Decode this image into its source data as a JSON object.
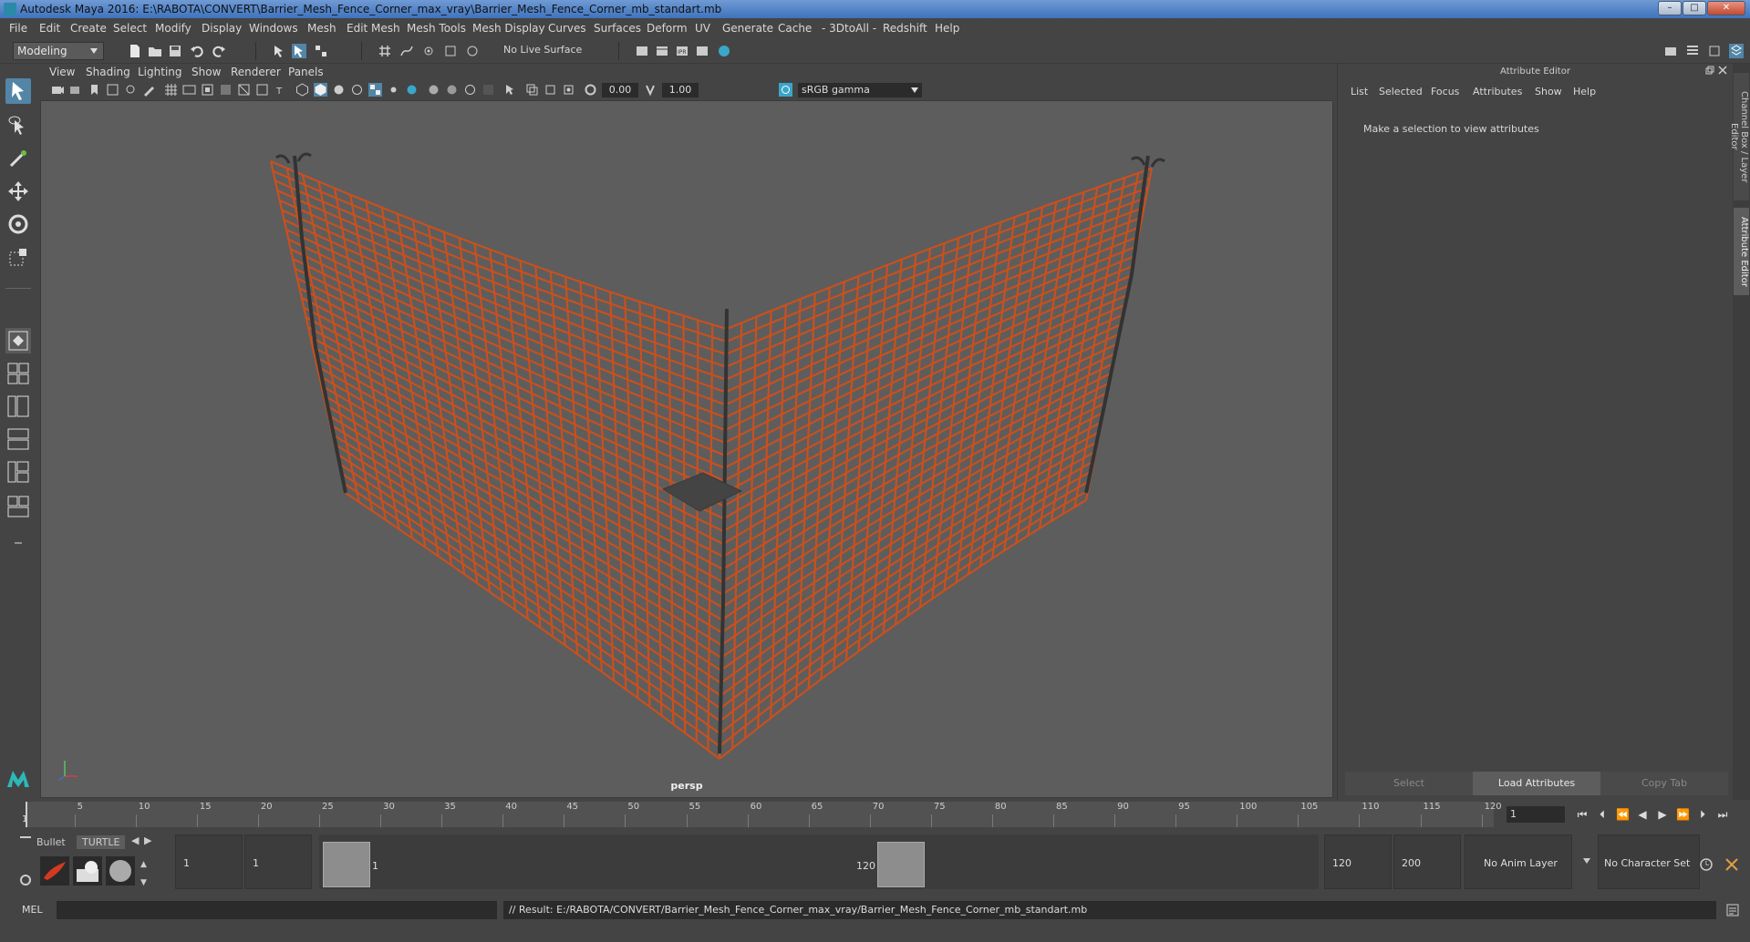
{
  "window": {
    "title": "Autodesk Maya 2016: E:\\RABOTA\\CONVERT\\Barrier_Mesh_Fence_Corner_max_vray\\Barrier_Mesh_Fence_Corner_mb_standart.mb",
    "minimize_label": "–",
    "maximize_label": "□",
    "close_label": "✕"
  },
  "menubar": [
    "File",
    "Edit",
    "Create",
    "Select",
    "Modify",
    "Display",
    "Windows",
    "Mesh",
    "Edit Mesh",
    "Mesh Tools",
    "Mesh Display",
    "Curves",
    "Surfaces",
    "Deform",
    "UV",
    "Generate",
    "Cache",
    "- 3DtoAll -",
    "Redshift",
    "Help"
  ],
  "statusline": {
    "mode": "Modeling",
    "live_surface": "No Live Surface"
  },
  "viewport": {
    "menus": [
      "View",
      "Shading",
      "Lighting",
      "Show",
      "Renderer",
      "Panels"
    ],
    "exposure": "0.00",
    "gamma": "1.00",
    "color_space": "sRGB gamma",
    "camera_label": "persp"
  },
  "attribute_editor": {
    "header": "Attribute Editor",
    "tabs": [
      "List",
      "Selected",
      "Focus",
      "Attributes",
      "Show",
      "Help"
    ],
    "message": "Make a selection to view attributes",
    "buttons": {
      "select": "Select",
      "load": "Load Attributes",
      "copy": "Copy Tab"
    }
  },
  "side_tabs": {
    "channel_box": "Channel Box / Layer Editor",
    "attribute_editor": "Attribute Editor"
  },
  "time_slider": {
    "start_label": "1",
    "ticks": [
      "5",
      "10",
      "15",
      "20",
      "25",
      "30",
      "35",
      "40",
      "45",
      "50",
      "55",
      "60",
      "65",
      "70",
      "75",
      "80",
      "85",
      "90",
      "95",
      "100",
      "105",
      "110",
      "115",
      "120"
    ],
    "current_frame": "1"
  },
  "range": {
    "shelf_tabs": [
      "Bullet",
      "TURTLE"
    ],
    "start_time": "1",
    "playback_start": "1",
    "range_start_label": "1",
    "range_end_label": "120",
    "playback_end": "120",
    "end_time": "200",
    "anim_layer": "No Anim Layer",
    "character_set": "No Character Set"
  },
  "command_line": {
    "label": "MEL",
    "result": "// Result: E:/RABOTA/CONVERT/Barrier_Mesh_Fence_Corner_max_vray/Barrier_Mesh_Fence_Corner_mb_standart.mb"
  },
  "colors": {
    "mesh_orange": "#c8501e",
    "post_dark": "#333333",
    "viewport_bg": "#5d5d5d",
    "accent_blue": "#5285a6"
  }
}
